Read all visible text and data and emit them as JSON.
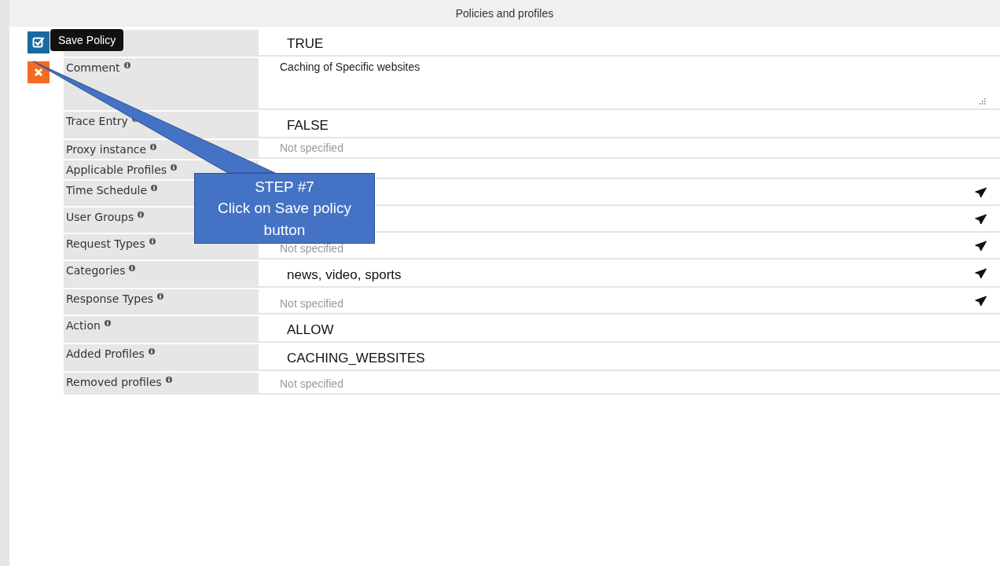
{
  "header": {
    "title": "Policies and profiles"
  },
  "tooltip": {
    "text": "Save Policy"
  },
  "rows": [
    {
      "kind": "big",
      "value": "TRUE",
      "picker": false
    },
    {
      "kind": "textarea",
      "label": "Comment",
      "value": "Caching of Specific websites",
      "picker": false
    },
    {
      "kind": "big",
      "label": "Trace Entry",
      "value": "FALSE",
      "picker": false
    },
    {
      "kind": "muted",
      "label": "Proxy instance",
      "value": "Not specified",
      "picker": false
    },
    {
      "kind": "muted",
      "label": "Applicable Profiles",
      "picker": false
    },
    {
      "kind": "muted",
      "label": "Time Schedule",
      "picker": true
    },
    {
      "kind": "muted",
      "label": "User Groups",
      "picker": true
    },
    {
      "kind": "muted",
      "label": "Request Types",
      "value": "Not specified",
      "picker": true
    },
    {
      "kind": "big",
      "label": "Categories",
      "value": "news,   video,   sports",
      "picker": true
    },
    {
      "kind": "muted",
      "label": "Response Types",
      "value": "Not specified",
      "picker": true
    },
    {
      "kind": "big",
      "label": "Action",
      "value": "ALLOW",
      "picker": false
    },
    {
      "kind": "big",
      "label": "Added Profiles",
      "value": "CACHING_WEBSITES",
      "picker": false
    },
    {
      "kind": "short",
      "label": "Removed profiles",
      "value": "Not specified",
      "picker": false
    }
  ],
  "callout": {
    "lines": [
      "STEP #7",
      "Click on Save policy button"
    ]
  }
}
